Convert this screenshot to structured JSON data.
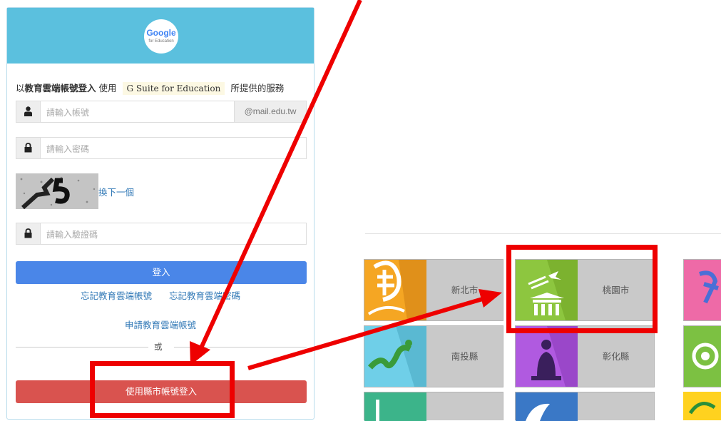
{
  "login": {
    "logo_text": "Google",
    "logo_sub": "for Education",
    "intro_prefix": "以",
    "intro_bold": "教育雲端帳號登入",
    "intro_mid": "使用",
    "intro_chip": "G Suite for Education",
    "intro_suffix": "所提供的服務",
    "account_placeholder": "請輸入帳號",
    "account_suffix": "@mail.edu.tw",
    "password_placeholder": "請輸入密碼",
    "captcha_next": "換下一個",
    "captcha_placeholder": "請輸入驗證碼",
    "login_button": "登入",
    "forgot_account": "忘記教育雲端帳號",
    "forgot_password": "忘記教育雲端密碼",
    "apply_account": "申請教育雲端帳號",
    "or_text": "或",
    "county_login_button": "使用縣市帳號登入"
  },
  "counties": {
    "new_taipei": "新北市",
    "taoyuan": "桃園市",
    "nantou": "南投縣",
    "changhua": "彰化縣"
  },
  "colors": {
    "header": "#5bc0de",
    "login_button": "#4a86e8",
    "county_button": "#d9534f",
    "annotation": "#ee0000",
    "new_taipei_tile": "#f5a623",
    "taoyuan_tile": "#8dc63f",
    "nantou_tile": "#6fcfe8",
    "changhua_tile": "#b05ae0"
  }
}
